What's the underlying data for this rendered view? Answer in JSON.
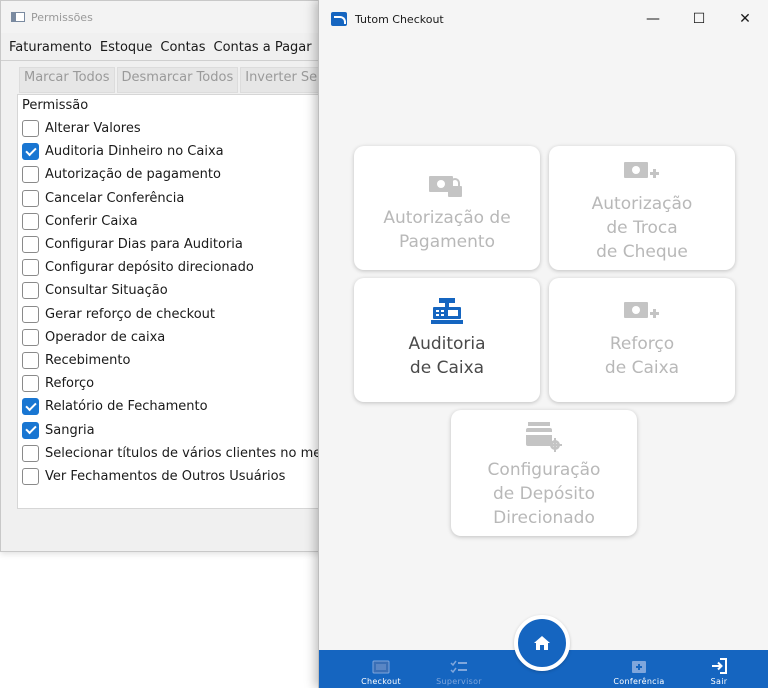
{
  "permissions_window": {
    "title": "Permissões",
    "tabs": [
      "Faturamento",
      "Estoque",
      "Contas",
      "Contas a Pagar"
    ],
    "toolbar": {
      "mark_all": "Marcar Todos",
      "unmark_all": "Desmarcar Todos",
      "invert": "Inverter Sele"
    },
    "list_header": "Permissão",
    "items": [
      {
        "label": "Alterar Valores",
        "checked": false
      },
      {
        "label": "Auditoria Dinheiro no Caixa",
        "checked": true
      },
      {
        "label": "Autorização de pagamento",
        "checked": false
      },
      {
        "label": "Cancelar Conferência",
        "checked": false
      },
      {
        "label": "Conferir Caixa",
        "checked": false
      },
      {
        "label": "Configurar Dias para Auditoria",
        "checked": false
      },
      {
        "label": "Configurar depósito direcionado",
        "checked": false
      },
      {
        "label": "Consultar Situação",
        "checked": false
      },
      {
        "label": "Gerar reforço de checkout",
        "checked": false
      },
      {
        "label": "Operador de caixa",
        "checked": false
      },
      {
        "label": "Recebimento",
        "checked": false
      },
      {
        "label": "Reforço",
        "checked": false
      },
      {
        "label": "Relatório de Fechamento",
        "checked": true
      },
      {
        "label": "Sangria",
        "checked": true
      },
      {
        "label": "Selecionar títulos de vários clientes no mesmo",
        "checked": false
      },
      {
        "label": "Ver Fechamentos de Outros Usuários",
        "checked": false
      }
    ]
  },
  "checkout_window": {
    "title": "Tutom Checkout",
    "controls": {
      "minimize": "—",
      "maximize": "☐",
      "close": "✕"
    },
    "tiles": {
      "auth_payment": {
        "label": "Autorização de\nPagamento",
        "icon": "cash-lock-icon",
        "enabled": false
      },
      "auth_check": {
        "label": "Autorização\nde Troca\nde Cheque",
        "icon": "cash-plus-icon",
        "enabled": false
      },
      "audit": {
        "label": "Auditoria\nde Caixa",
        "icon": "cash-register-icon",
        "enabled": true
      },
      "reinforcement": {
        "label": "Reforço\nde Caixa",
        "icon": "cash-plus-icon",
        "enabled": false
      },
      "deposit_config": {
        "label": "Configuração\nde Depósito\nDirecionado",
        "icon": "card-gear-icon",
        "enabled": false
      }
    },
    "nav": {
      "checkout": "Checkout",
      "supervisor": "Supervisor",
      "conferencia": "Conferência",
      "sair": "Sair"
    },
    "colors": {
      "accent": "#1565c0",
      "disabled_text": "#b8b8b8",
      "active_text": "#4a4a4a"
    }
  }
}
